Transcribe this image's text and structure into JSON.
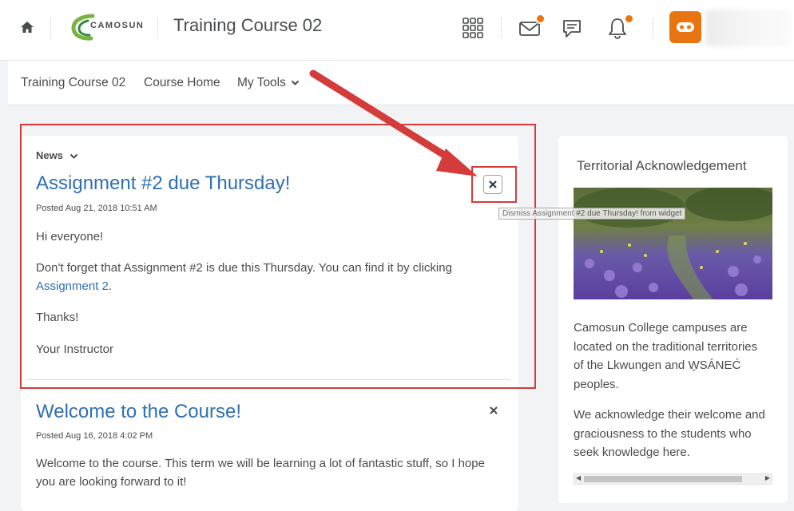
{
  "header": {
    "logo_text": "CAMOSUN",
    "course_title": "Training Course 02"
  },
  "nav": {
    "items": [
      {
        "label": "Training Course 02"
      },
      {
        "label": "Course Home"
      },
      {
        "label": "My Tools"
      }
    ]
  },
  "news": {
    "header": "News",
    "items": [
      {
        "title": "Assignment #2 due Thursday!",
        "posted": "Posted Aug 21, 2018 10:51 AM",
        "p1": "Hi everyone!",
        "p2_text": "Don't forget that Assignment #2 is due this Thursday.  You can find it by clicking ",
        "p2_link": "Assignment 2",
        "p2_end": ".",
        "p3": "Thanks!",
        "p4": "Your Instructor"
      },
      {
        "title": "Welcome to the Course!",
        "posted": "Posted Aug 16, 2018 4:02 PM",
        "p1": "Welcome to the course.  This term we will be learning a lot of fantastic stuff, so I hope you are looking forward to it!"
      }
    ],
    "dismiss_tooltip": "Dismiss Assignment #2 due Thursday! from widget"
  },
  "territorial": {
    "title": "Territorial Acknowledgement",
    "p1": "Camosun College campuses are located on the traditional territories of the Lkwungen and W̱SÁNEĆ peoples.",
    "p2": "We acknowledge their welcome and graciousness to the students who seek knowledge here."
  },
  "colors": {
    "accent": "#e87511",
    "link": "#2e6fb4",
    "annotation": "#d43c3c"
  }
}
